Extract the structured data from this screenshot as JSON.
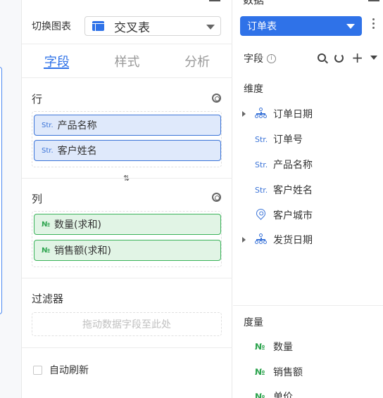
{
  "middle_panel": {
    "switch_chart_label": "切换图表",
    "chart_type": "交叉表",
    "tabs": [
      {
        "label": "字段",
        "active": true
      },
      {
        "label": "样式",
        "active": false
      },
      {
        "label": "分析",
        "active": false
      }
    ],
    "rows_section": {
      "title": "行",
      "items": [
        {
          "type_icon": "Str.",
          "label": "产品名称"
        },
        {
          "type_icon": "Str.",
          "label": "客户姓名"
        }
      ]
    },
    "swap_icon": "⇅",
    "columns_section": {
      "title": "列",
      "items": [
        {
          "type_icon": "№",
          "label": "数量(求和)"
        },
        {
          "type_icon": "№",
          "label": "销售额(求和)"
        }
      ]
    },
    "filter_section": {
      "title": "过滤器",
      "placeholder": "拖动数据字段至此处"
    },
    "auto_refresh_label": "自动刷新"
  },
  "right_panel": {
    "title": "数据",
    "table_name": "订单表",
    "fields_label": "字段",
    "dimension_group": {
      "title": "维度",
      "items": [
        {
          "icon": "hierarchy-icon",
          "label": "订单日期"
        },
        {
          "icon": "Str.",
          "label": "订单号"
        },
        {
          "icon": "Str.",
          "label": "产品名称"
        },
        {
          "icon": "Str.",
          "label": "客户姓名"
        },
        {
          "icon": "location-pin-icon",
          "label": "客户城市"
        },
        {
          "icon": "hierarchy-icon",
          "label": "发货日期"
        }
      ]
    },
    "measure_group": {
      "title": "度量",
      "items": [
        {
          "icon": "№",
          "label": "数量"
        },
        {
          "icon": "№",
          "label": "销售额"
        },
        {
          "icon": "№",
          "label": "单价"
        }
      ]
    }
  },
  "colors": {
    "accent": "#2f72e8",
    "dimension_pill_bg": "#dfe9fb",
    "measure_pill_bg": "#e1f4e5",
    "measure_green": "#2ea44f"
  }
}
